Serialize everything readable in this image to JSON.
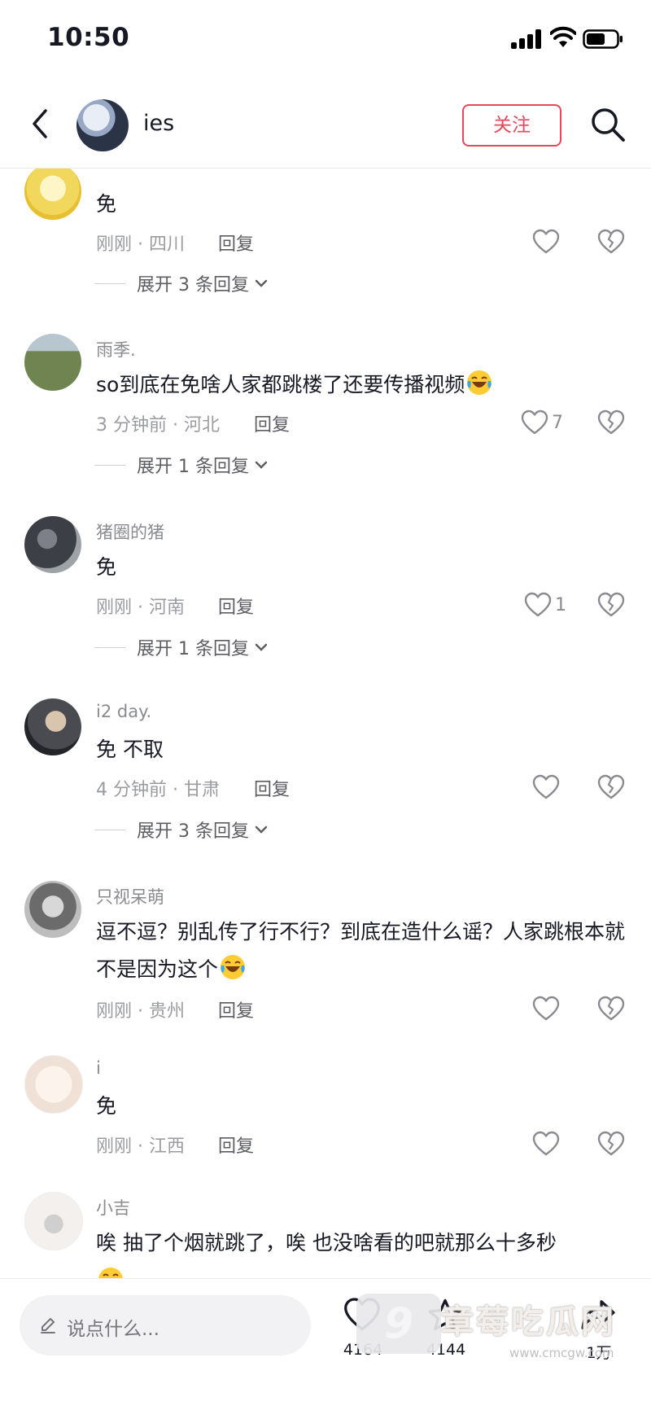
{
  "status_bar": {
    "time": "10:50"
  },
  "header": {
    "name": "ies",
    "follow_label": "关注"
  },
  "comments": [
    {
      "user": "",
      "text": "免",
      "time": "刚刚 · 四川",
      "reply": "回复",
      "likes": "",
      "expand": "展开 3 条回复"
    },
    {
      "user": "雨季.",
      "text": "so到底在免啥人家都跳楼了还要传播视频",
      "time": "3 分钟前 · 河北",
      "reply": "回复",
      "likes": "7",
      "expand": "展开 1 条回复"
    },
    {
      "user": "猪圈的猪",
      "text": "免",
      "time": "刚刚 · 河南",
      "reply": "回复",
      "likes": "1",
      "expand": "展开 1 条回复"
    },
    {
      "user": "i2 day.",
      "text": "免 不取",
      "time": "4 分钟前 · 甘肃",
      "reply": "回复",
      "likes": "",
      "expand": "展开 3 条回复"
    },
    {
      "user": "只视呆萌",
      "text": "逗不逗？别乱传了行不行？到底在造什么谣？人家跳根本就不是因为这个",
      "time": "刚刚 · 贵州",
      "reply": "回复",
      "likes": "",
      "expand": ""
    },
    {
      "user": "i",
      "text": "免",
      "time": "刚刚 · 江西",
      "reply": "回复",
      "likes": "",
      "expand": ""
    },
    {
      "user": "小吉",
      "text": "唉 抽了个烟就跳了，唉 也没啥看的吧就那么十多秒",
      "time": "",
      "reply": "",
      "likes": "",
      "expand": ""
    }
  ],
  "bottom_bar": {
    "input_placeholder": "说点什么...",
    "like_count": "4164",
    "favorite_count": "4144",
    "share_count": "1万",
    "watermark_text": "章莓吃瓜网",
    "watermark_url": "www.cmcgw.com"
  },
  "colors": {
    "accent": "#e8465c",
    "muted_text": "#9b9ca2",
    "primary_text": "#161823"
  },
  "icons": [
    "back-arrow-icon",
    "search-icon",
    "heart-icon",
    "broken-heart-icon",
    "chevron-down-icon",
    "pencil-icon",
    "laugh-cry-emoji",
    "star-icon",
    "share-icon"
  ]
}
